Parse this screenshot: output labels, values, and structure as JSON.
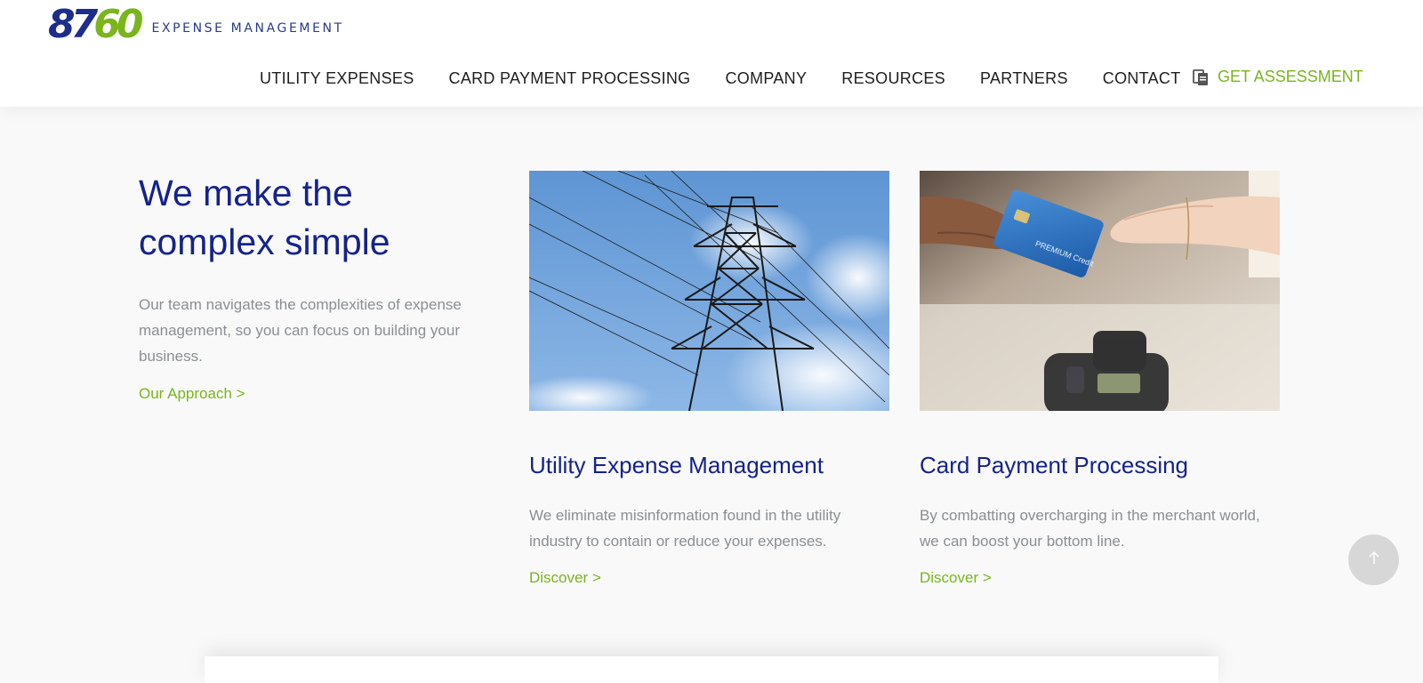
{
  "header": {
    "logo_number_part1": "87",
    "logo_number_part2": "60",
    "logo_text": "EXPENSE MANAGEMENT",
    "nav": [
      {
        "label": "UTILITY EXPENSES"
      },
      {
        "label": "CARD PAYMENT PROCESSING"
      },
      {
        "label": "COMPANY"
      },
      {
        "label": "RESOURCES"
      },
      {
        "label": "PARTNERS"
      },
      {
        "label": "CONTACT"
      }
    ],
    "cta_label": "GET ASSESSMENT",
    "cta_icon": "clipboard-icon"
  },
  "intro": {
    "title": "We make the complex simple",
    "text": "Our team navigates the complexities of expense management, so you can focus on building your business.",
    "link": "Our Approach >"
  },
  "cards": [
    {
      "title": "Utility Expense Management",
      "text": "We eliminate misinformation found in the utility industry to contain or reduce your expenses.",
      "link": "Discover >",
      "image": "power-line-tower-image"
    },
    {
      "title": "Card Payment Processing",
      "text": "By combatting overcharging in the merchant world, we can boost your bottom line.",
      "link": "Discover >",
      "image": "credit-card-handoff-image",
      "card_text_on_image": "PREMIUM Credit"
    }
  ],
  "scroll_top_icon": "arrow-up-icon",
  "colors": {
    "brand_blue": "#15238a",
    "brand_green": "#7ab51d",
    "body_text": "#8a8f94"
  }
}
